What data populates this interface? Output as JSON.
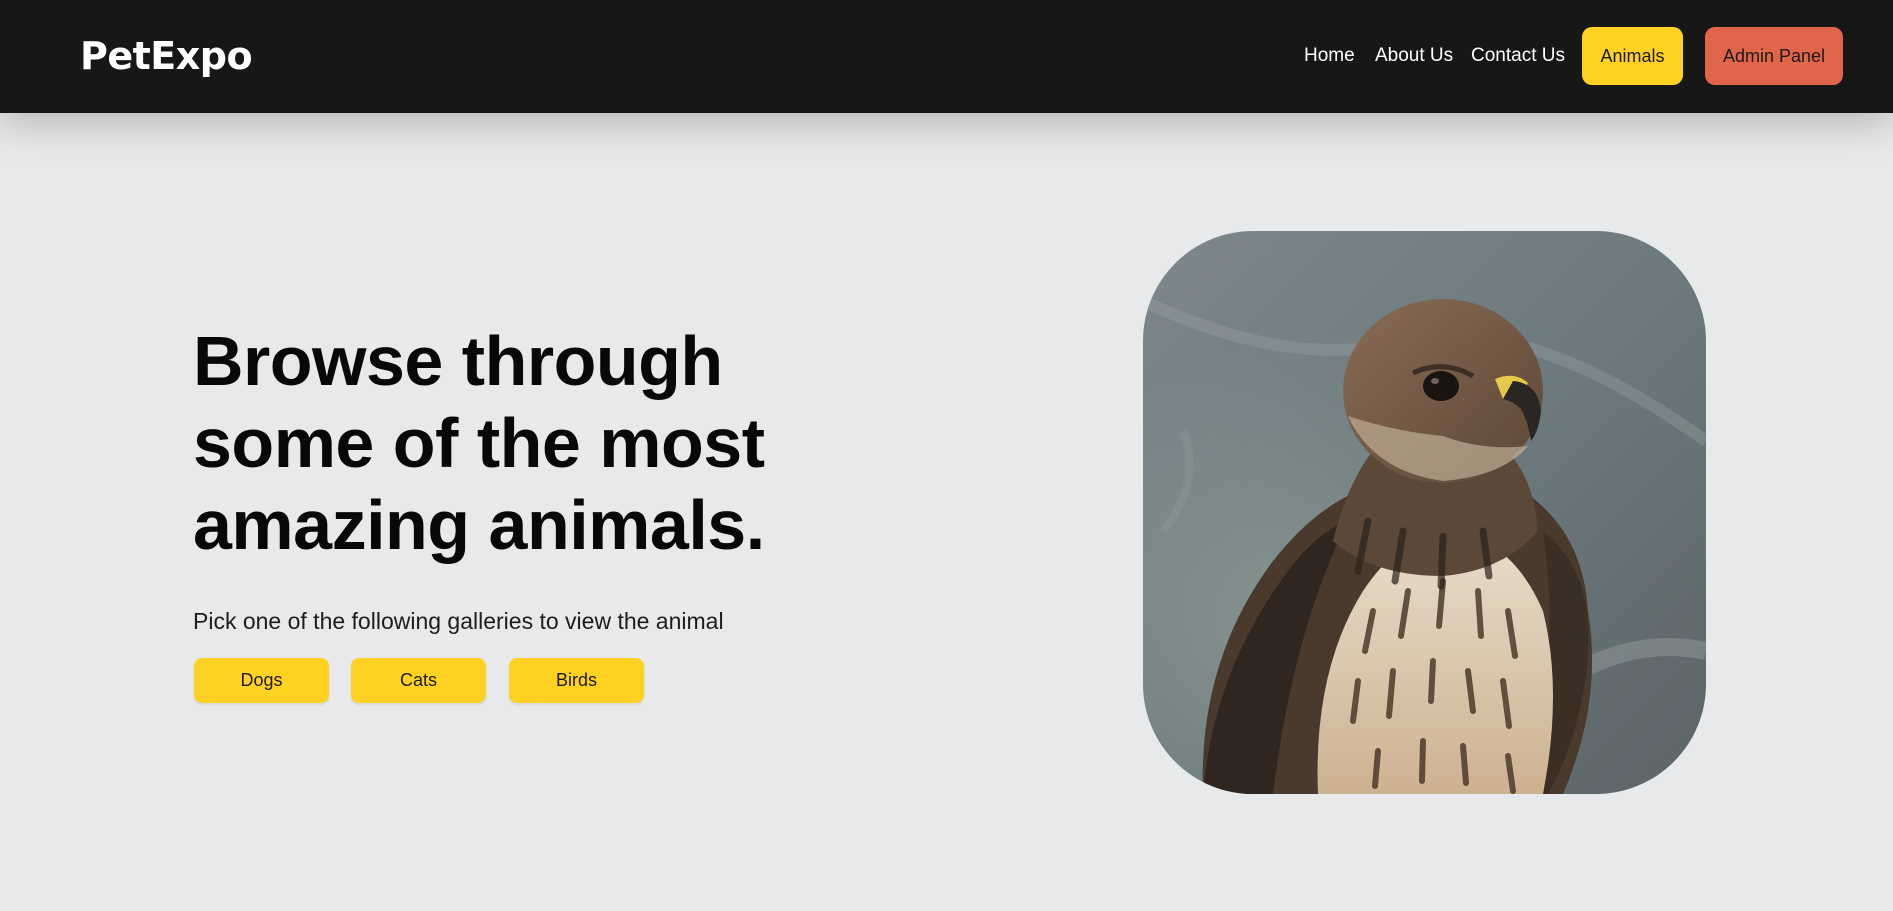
{
  "app": {
    "logo": "PetExpo"
  },
  "nav": {
    "links": [
      "Home",
      "About Us",
      "Contact Us"
    ],
    "animals_button": "Animals",
    "admin_button": "Admin Panel"
  },
  "hero": {
    "title": "Browse through some of the most amazing animals.",
    "subtitle": "Pick one of the following galleries to view the animal",
    "galleries": [
      "Dogs",
      "Cats",
      "Birds"
    ],
    "image_subject": "hawk-photo"
  },
  "colors": {
    "navbar_bg": "#171717",
    "page_bg": "#e8e9ea",
    "accent_yellow": "#ffd123",
    "accent_orange": "#e0654a"
  }
}
